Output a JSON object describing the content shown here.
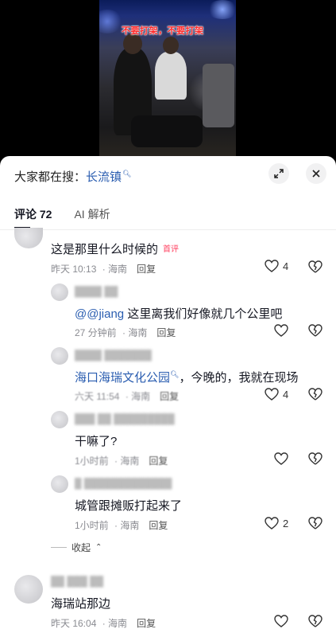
{
  "video": {
    "caption": "不要打架，不要打架"
  },
  "header": {
    "search_prefix": "大家都在搜：",
    "search_keyword": "长流镇",
    "expand_icon": "expand-icon",
    "close_icon": "close-icon"
  },
  "tabs": [
    {
      "label": "评论 72",
      "active": true
    },
    {
      "label": "AI 解析",
      "active": false
    }
  ],
  "comments": [
    {
      "text": "这是那里什么时候的",
      "author_tag": "首评",
      "time": "昨天 10:13",
      "location": "海南",
      "reply_label": "回复",
      "likes": "4",
      "replies": [
        {
          "mention": "@@jiang",
          "text": " 这里离我们好像就几个公里吧",
          "time": "27 分钟前",
          "location": "海南",
          "reply_label": "回复",
          "likes": ""
        },
        {
          "place": "海口海瑞文化公园",
          "text": "，今晚的，我就在现场",
          "time": "六天 11:54",
          "location": "海南",
          "reply_label": "回复",
          "likes": "4"
        },
        {
          "text": "干嘛了?",
          "time": "1小时前",
          "location": "海南",
          "reply_label": "回复",
          "likes": ""
        },
        {
          "text": "城管跟摊贩打起来了",
          "time": "1小时前",
          "location": "海南",
          "reply_label": "回复",
          "likes": "2"
        }
      ],
      "collapse_label": "收起"
    },
    {
      "text": "海瑞站那边",
      "time": "昨天 16:04",
      "location": "海南",
      "reply_label": "回复",
      "likes": ""
    }
  ],
  "colors": {
    "link": "#2a5db0",
    "author_tag": "#ff3f5f",
    "caption": "#ff2b2b"
  }
}
